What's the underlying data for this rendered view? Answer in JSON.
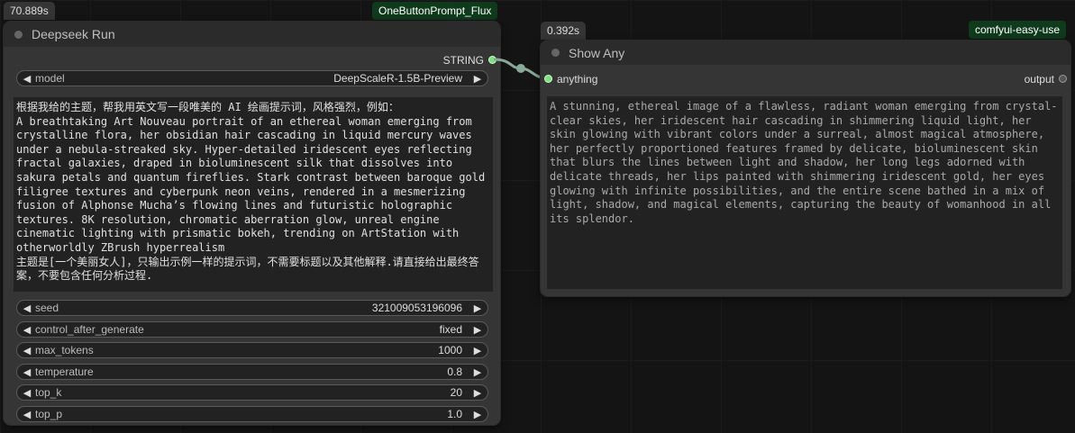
{
  "deepseek_node": {
    "time_badge": "70.889s",
    "tag": "OneButtonPrompt_Flux",
    "title": "Deepseek Run",
    "output_label": "STRING",
    "model": {
      "name": "model",
      "value": "DeepScaleR-1.5B-Preview"
    },
    "prompt_text": "根据我给的主题，帮我用英文写一段唯美的 AI 绘画提示词，风格强烈，例如：\nA breathtaking Art Nouveau portrait of an ethereal woman emerging from crystalline flora, her obsidian hair cascading in liquid mercury waves under a nebula-streaked sky. Hyper-detailed iridescent eyes reflecting fractal galaxies, draped in bioluminescent silk that dissolves into sakura petals and quantum fireflies. Stark contrast between baroque gold filigree textures and cyberpunk neon veins, rendered in a mesmerizing fusion of Alphonse Mucha’s flowing lines and futuristic holographic textures. 8K resolution, chromatic aberration glow, unreal engine cinematic lighting with prismatic bokeh, trending on ArtStation with otherworldly ZBrush hyperrealism\n主题是[一个美丽女人]，只输出示例一样的提示词，不需要标题以及其他解释.请直接给出最终答案，不要包含任何分析过程.",
    "widgets": [
      {
        "name": "seed",
        "value": "321009053196096"
      },
      {
        "name": "control_after_generate",
        "value": "fixed"
      },
      {
        "name": "max_tokens",
        "value": "1000"
      },
      {
        "name": "temperature",
        "value": "0.8"
      },
      {
        "name": "top_k",
        "value": "20"
      },
      {
        "name": "top_p",
        "value": "1.0"
      }
    ]
  },
  "show_node": {
    "time_badge": "0.392s",
    "tag": "comfyui-easy-use",
    "title": "Show Any",
    "input_label": "anything",
    "output_label": "output",
    "text": "A stunning, ethereal image of a flawless, radiant woman emerging from crystal-clear skies, her iridescent hair cascading in shimmering liquid light, her skin glowing with vibrant colors under a surreal, almost magical atmosphere, her perfectly proportioned features framed by delicate, bioluminescent skin that blurs the lines between light and shadow, her long legs adorned with delicate threads, her lips painted with shimmering iridescent gold, her eyes glowing with infinite possibilities, and the entire scene bathed in a mix of light, shadow, and magical elements, capturing the beauty of womanhood in all its splendor."
  },
  "colors": {
    "slot_green": "#7fe07f",
    "tag_bg": "#0f3a1c",
    "link": "#8aa89a"
  }
}
